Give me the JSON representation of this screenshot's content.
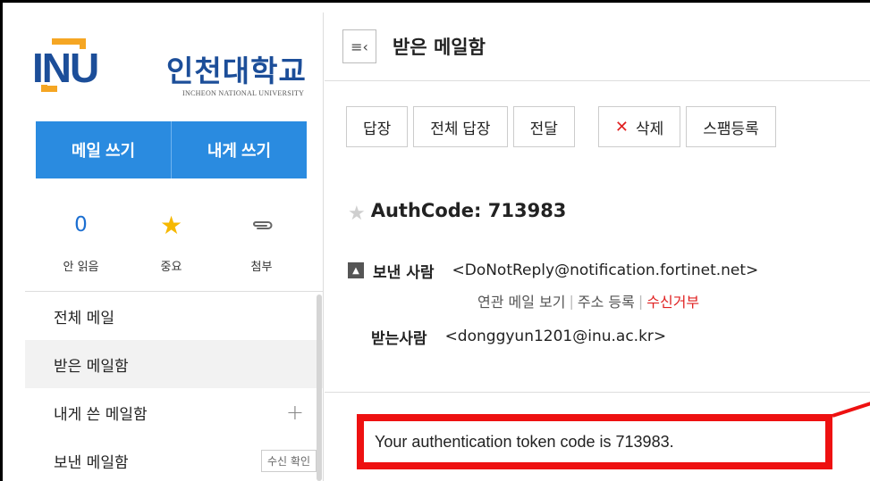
{
  "sidebar": {
    "logo_mark": "INU",
    "logo_korean": "인천대학교",
    "logo_english": "INCHEON NATIONAL UNIVERSITY",
    "compose": {
      "write_mail": "메일 쓰기",
      "write_to_self": "내게 쓰기"
    },
    "quick": [
      {
        "value": "0",
        "label": "안 읽음",
        "icon": "count"
      },
      {
        "value": "★",
        "label": "중요",
        "icon": "star-icon"
      },
      {
        "value": "⌀",
        "label": "첨부",
        "icon": "paperclip-icon"
      }
    ],
    "nav": [
      {
        "label": "전체 메일"
      },
      {
        "label": "받은 메일함"
      },
      {
        "label": "내게 쓴 메일함",
        "extra": "+"
      },
      {
        "label": "보낸 메일함",
        "badge": "수신 확인"
      }
    ]
  },
  "header": {
    "toggle_icon": "≡‹",
    "title": "받은 메일함"
  },
  "toolbar": {
    "reply": "답장",
    "reply_all": "전체 답장",
    "forward": "전달",
    "delete_icon": "✕",
    "delete": "삭제",
    "spam": "스팸등록"
  },
  "message": {
    "subject": "AuthCode: 713983",
    "sender_label": "보낸 사람",
    "sender": "<DoNotReply@notification.fortinet.net>",
    "related_mail": "연관 메일 보기",
    "add_address": "주소 등록",
    "block": "수신거부",
    "recipient_label": "받는사람",
    "recipient": "<donggyun1201@inu.ac.kr>",
    "body": "Your authentication token code is 713983."
  },
  "colors": {
    "accent": "#2a8be0",
    "brand": "#1c4e99",
    "highlight": "#ee1111",
    "star": "#f6b800"
  }
}
